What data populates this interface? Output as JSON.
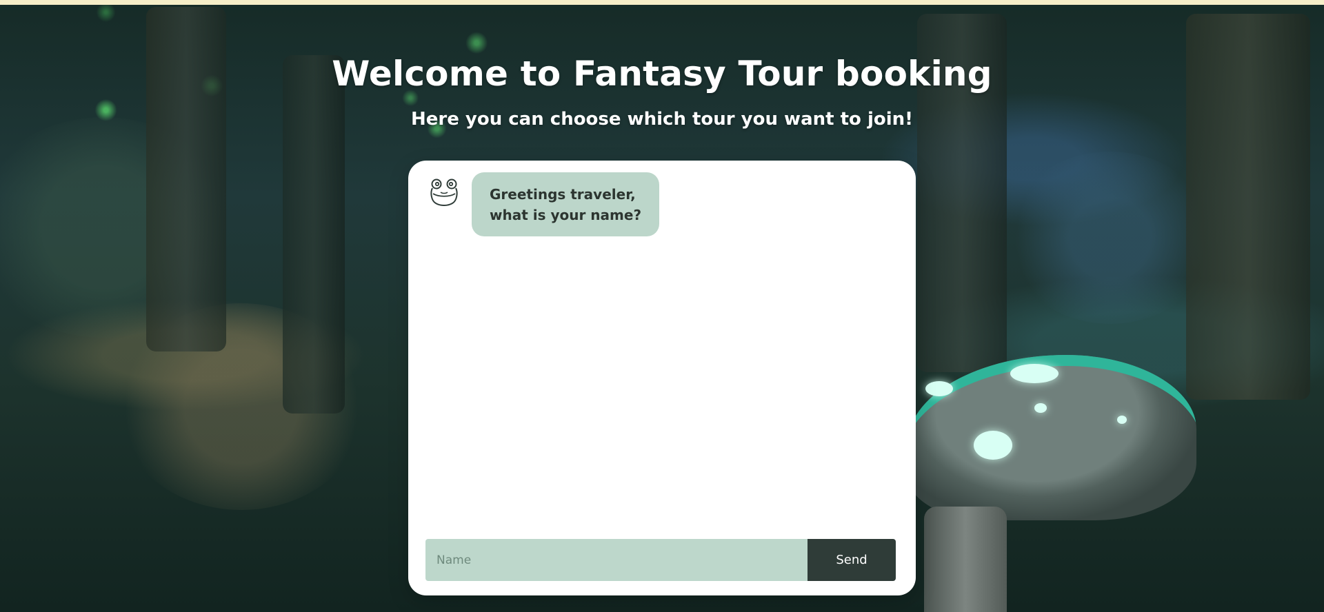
{
  "hero": {
    "title": "Welcome to Fantasy Tour booking",
    "subtitle": "Here you can choose which tour you want to join!"
  },
  "chat": {
    "bot_icon": "frog-icon",
    "messages": [
      {
        "sender": "bot",
        "text": "Greetings traveler,\nwhat is your name?"
      }
    ],
    "input": {
      "placeholder": "Name",
      "value": ""
    },
    "send_label": "Send"
  },
  "colors": {
    "top_bar": "#f6eec8",
    "card": "#ffffff",
    "bubble": "#bcd6ca",
    "input": "#bdd7cb",
    "send_button": "#2f3c38",
    "text_dark": "#2c3530"
  }
}
